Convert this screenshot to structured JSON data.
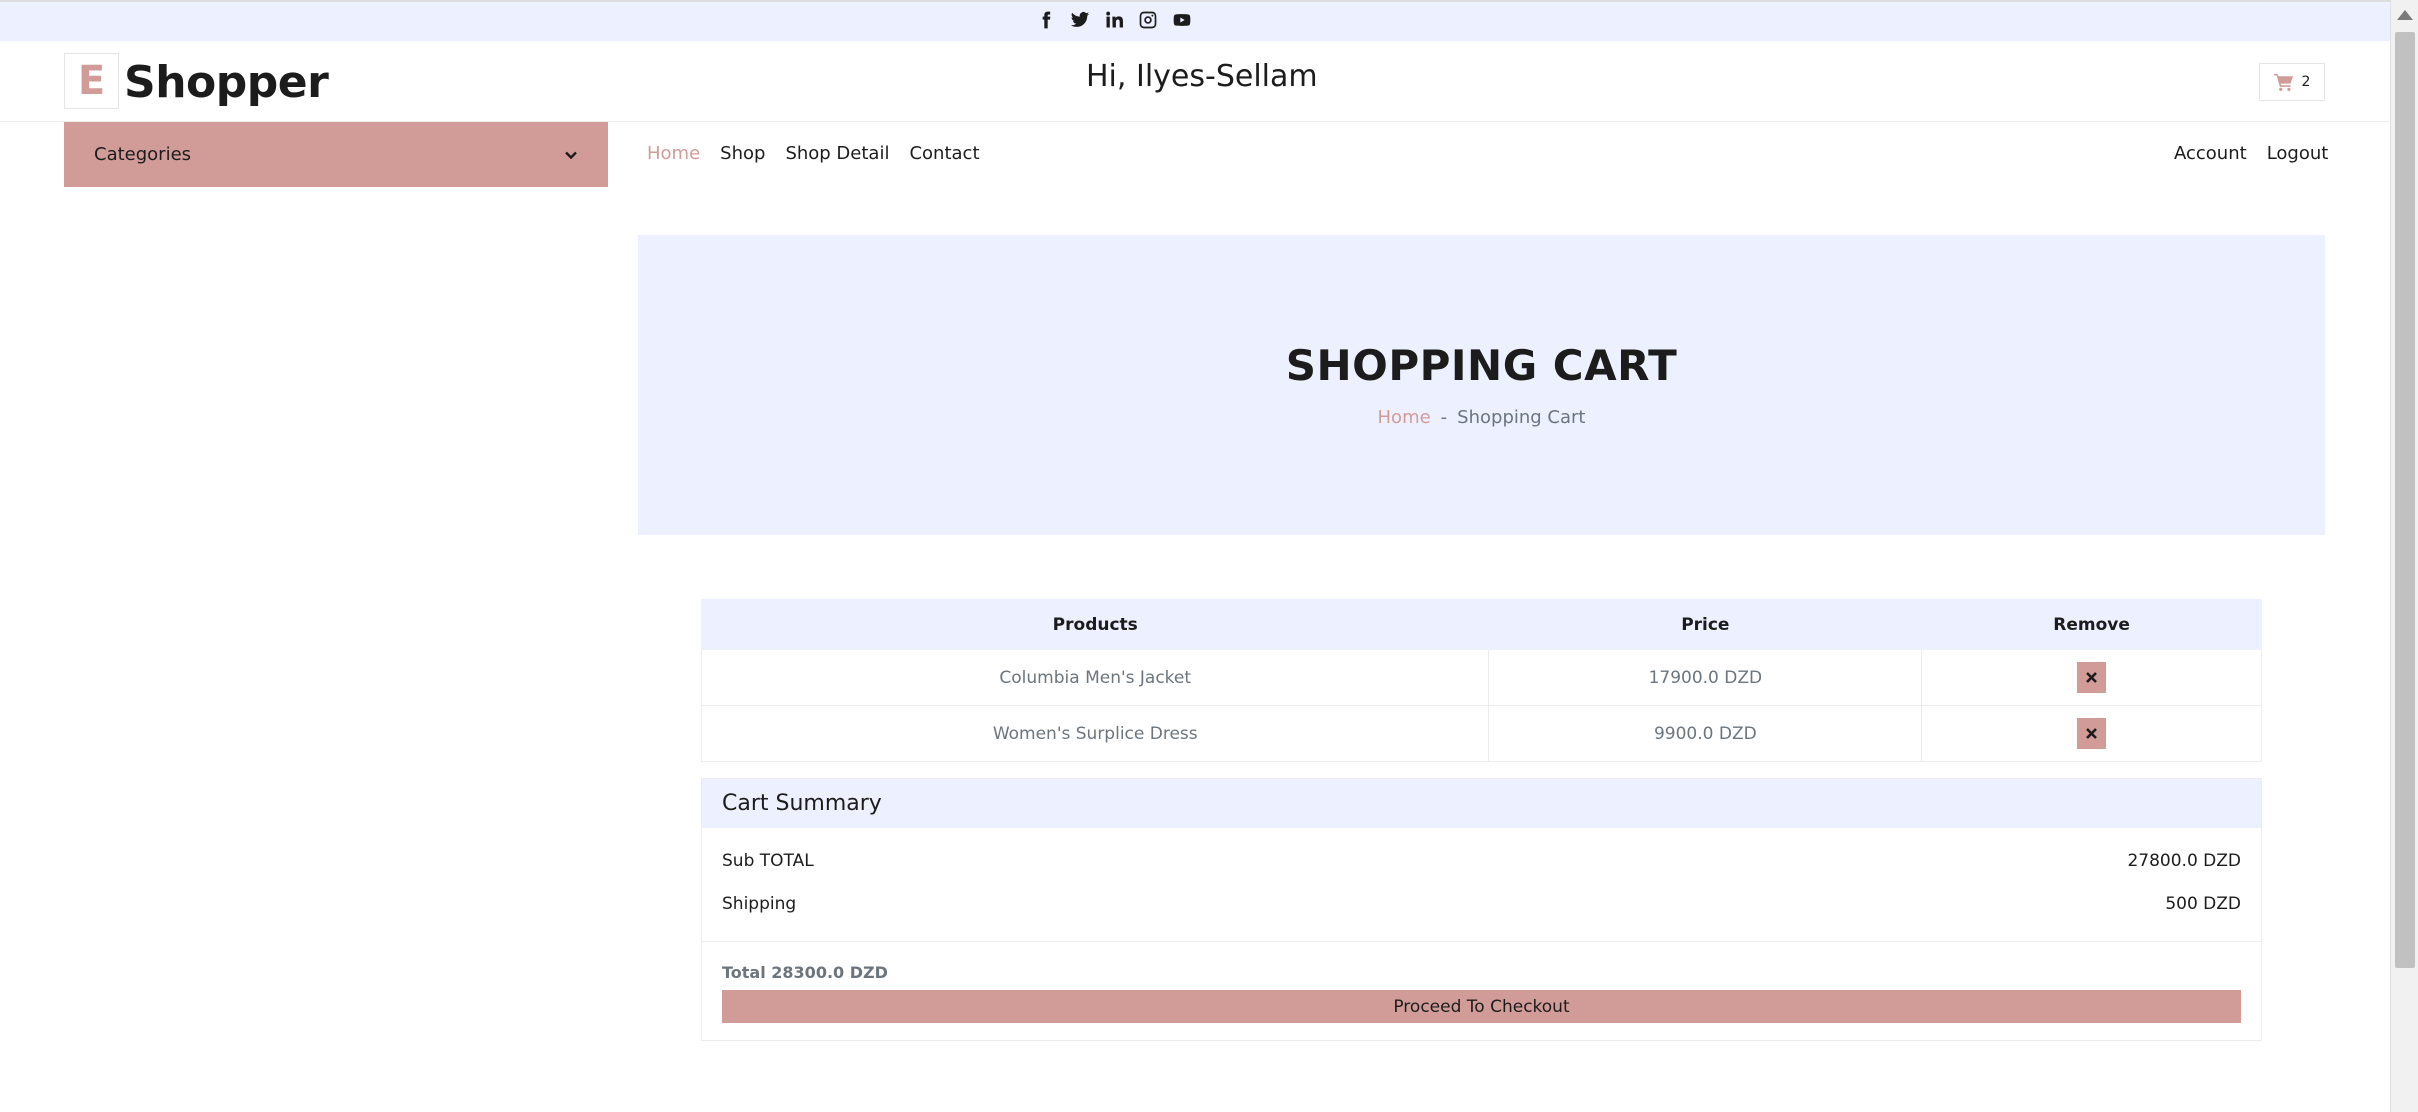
{
  "social": [
    "facebook-icon",
    "twitter-icon",
    "linkedin-icon",
    "instagram-icon",
    "youtube-icon"
  ],
  "brand": {
    "logo_letter": "E",
    "name": "Shopper",
    "accent": "#d19c97"
  },
  "greeting": "Hi, Ilyes-Sellam",
  "cart": {
    "count": "2"
  },
  "categories": {
    "label": "Categories"
  },
  "nav": {
    "home": "Home",
    "shop": "Shop",
    "shop_detail": "Shop Detail",
    "contact": "Contact",
    "account": "Account",
    "logout": "Logout"
  },
  "hero": {
    "title": "SHOPPING CART",
    "crumb_home": "Home",
    "crumb_sep": "-",
    "crumb_current": "Shopping Cart"
  },
  "table": {
    "headers": {
      "products": "Products",
      "price": "Price",
      "remove": "Remove"
    },
    "rows": [
      {
        "product": "Columbia Men's Jacket",
        "price": "17900.0 DZD"
      },
      {
        "product": "Women's Surplice Dress",
        "price": "9900.0 DZD"
      }
    ]
  },
  "summary": {
    "title": "Cart Summary",
    "subtotal_label": "Sub TOTAL",
    "subtotal_value": "27800.0 DZD",
    "shipping_label": "Shipping",
    "shipping_value": "500 DZD",
    "total": "Total 28300.0 DZD",
    "checkout_label": "Proceed To Checkout"
  }
}
